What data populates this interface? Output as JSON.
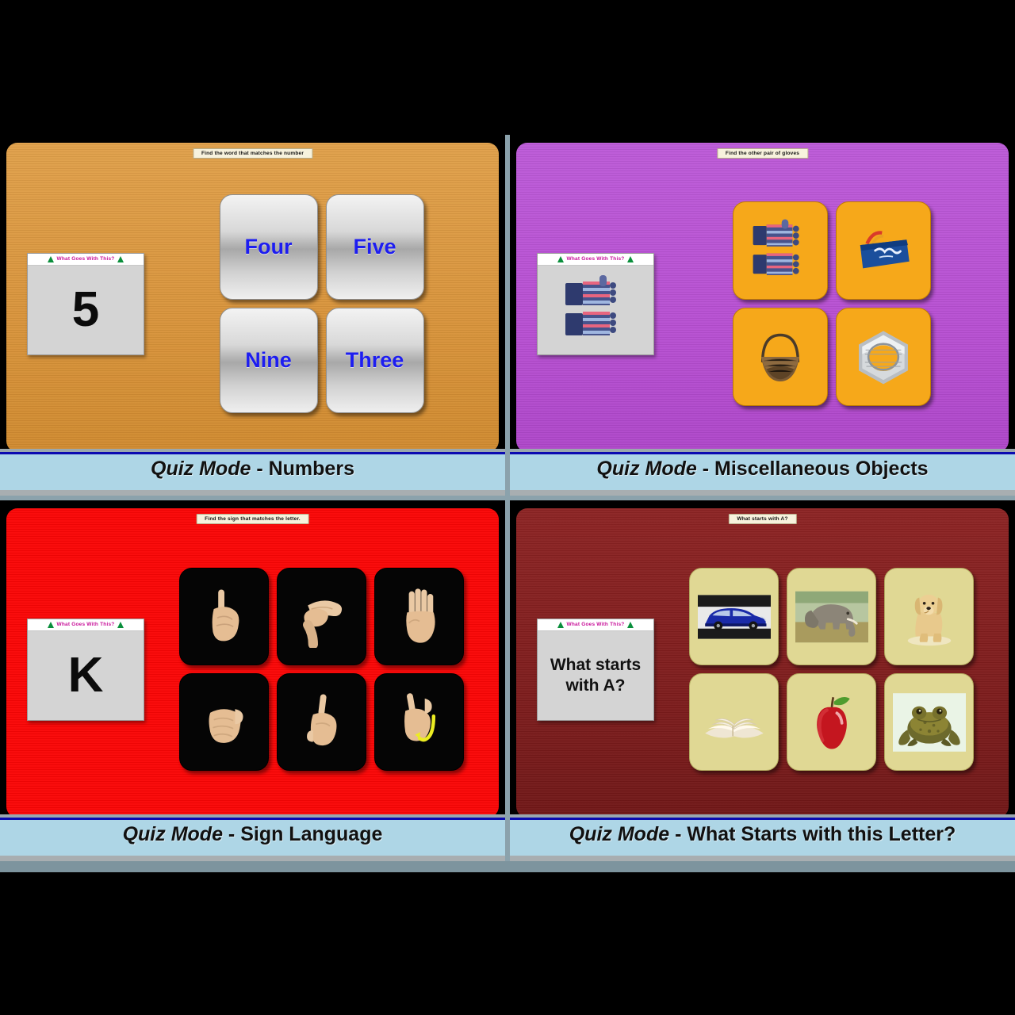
{
  "theme": {
    "page_bg": "#000000",
    "gutter": "#8ba2ac",
    "caption_bg": "#aed6e6",
    "caption_rule": "#0b0bb0",
    "card_title_color": "#c8129a",
    "answer_word_color": "#1d1df0"
  },
  "common": {
    "card_title": "What Goes With This?",
    "mode_label": "Quiz Mode",
    "dash": " - "
  },
  "panels": [
    {
      "id": "numbers",
      "board_color": "#d8933a",
      "prompt": "Find the word that matches the number",
      "card": {
        "kind": "number",
        "value": "5"
      },
      "answers": {
        "layout": "2x2",
        "tile_style": "silver",
        "items": [
          {
            "label": "Four",
            "icon": ""
          },
          {
            "label": "Five",
            "icon": ""
          },
          {
            "label": "Nine",
            "icon": ""
          },
          {
            "label": "Three",
            "icon": ""
          }
        ]
      },
      "caption_topic": "Numbers"
    },
    {
      "id": "misc-objects",
      "board_color": "#b74fd2",
      "prompt": "Find the other pair of gloves",
      "card": {
        "kind": "image",
        "value": "striped-gloves-image"
      },
      "answers": {
        "layout": "2x2",
        "tile_style": "amber",
        "items": [
          {
            "label": "",
            "icon": "striped-gloves-icon"
          },
          {
            "label": "",
            "icon": "blue-pouch-icon"
          },
          {
            "label": "",
            "icon": "wicker-basket-icon"
          },
          {
            "label": "",
            "icon": "hex-nut-icon"
          }
        ]
      },
      "caption_topic": "Miscellaneous Objects"
    },
    {
      "id": "sign-language",
      "board_color": "#fa0505",
      "prompt": "Find the sign that matches the letter.",
      "card": {
        "kind": "letter",
        "value": "K"
      },
      "answers": {
        "layout": "3x2",
        "tile_style": "black",
        "items": [
          {
            "label": "",
            "icon": "asl-hand-d-icon"
          },
          {
            "label": "",
            "icon": "asl-hand-c-icon"
          },
          {
            "label": "",
            "icon": "asl-hand-b-icon"
          },
          {
            "label": "",
            "icon": "asl-hand-a-icon"
          },
          {
            "label": "",
            "icon": "asl-hand-x-icon"
          },
          {
            "label": "",
            "icon": "asl-hand-j-icon"
          }
        ]
      },
      "caption_topic": "Sign Language"
    },
    {
      "id": "what-starts-with-letter",
      "board_color": "#7d1c1c",
      "prompt": "What starts with A?",
      "card": {
        "kind": "text",
        "value": "What starts with A?"
      },
      "answers": {
        "layout": "3x2",
        "tile_style": "khaki",
        "items": [
          {
            "label": "",
            "icon": "blue-car-icon"
          },
          {
            "label": "",
            "icon": "elephant-icon"
          },
          {
            "label": "",
            "icon": "dog-icon"
          },
          {
            "label": "",
            "icon": "open-book-icon"
          },
          {
            "label": "",
            "icon": "red-apple-icon"
          },
          {
            "label": "",
            "icon": "toad-icon"
          }
        ]
      },
      "caption_topic": "What Starts with this Letter?"
    }
  ]
}
